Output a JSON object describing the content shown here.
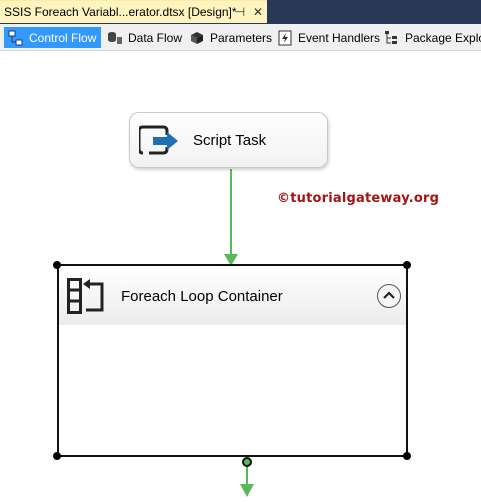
{
  "document_tab": {
    "title": "SSIS Foreach Variabl...erator.dtsx [Design]*",
    "pin_glyph": "⊣",
    "close_glyph": "✕"
  },
  "designer_tabs": [
    {
      "label": "Control Flow",
      "icon": "control-flow-icon",
      "active": true
    },
    {
      "label": "Data Flow",
      "icon": "data-flow-icon",
      "active": false
    },
    {
      "label": "Parameters",
      "icon": "parameters-icon",
      "active": false
    },
    {
      "label": "Event Handlers",
      "icon": "event-handlers-icon",
      "active": false
    },
    {
      "label": "Package Explore",
      "icon": "package-explorer-icon",
      "active": false
    }
  ],
  "canvas": {
    "script_task": {
      "label": "Script Task",
      "icon": "script-task-icon"
    },
    "watermark": "©tutorialgateway.org",
    "foreach_container": {
      "label": "Foreach Loop Container",
      "icon": "foreach-loop-icon",
      "collapse_icon": "chevron-up-icon"
    }
  },
  "colors": {
    "doc_tab_bg": "#fdf4bf",
    "tabbar_bg": "#293955",
    "active_tab": "#3399ff",
    "precedence_arrow": "#5cb85c",
    "watermark": "#a51414"
  }
}
